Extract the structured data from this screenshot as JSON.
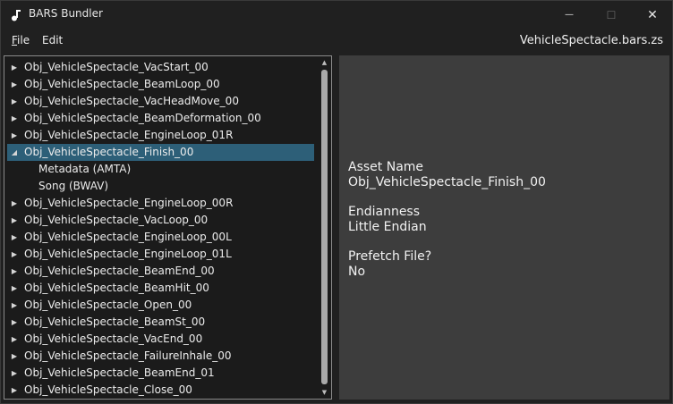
{
  "window": {
    "title": "BARS Bundler",
    "minimize_glyph": "—",
    "maximize_glyph": "☐",
    "close_glyph": "✕"
  },
  "menu": {
    "file_accel": "F",
    "file_rest": "ile",
    "edit": "Edit",
    "filename": "VehicleSpectacle.bars.zs"
  },
  "tree": {
    "collapsed_glyph": "▶",
    "expanded_glyph": "◢",
    "items": [
      {
        "label": "Obj_VehicleSpectacle_VacStart_00",
        "expanded": false
      },
      {
        "label": "Obj_VehicleSpectacle_BeamLoop_00",
        "expanded": false
      },
      {
        "label": "Obj_VehicleSpectacle_VacHeadMove_00",
        "expanded": false
      },
      {
        "label": "Obj_VehicleSpectacle_BeamDeformation_00",
        "expanded": false
      },
      {
        "label": "Obj_VehicleSpectacle_EngineLoop_01R",
        "expanded": false
      },
      {
        "label": "Obj_VehicleSpectacle_Finish_00",
        "expanded": true,
        "selected": true
      },
      {
        "label": "Metadata (AMTA)",
        "child": true
      },
      {
        "label": "Song (BWAV)",
        "child": true
      },
      {
        "label": "Obj_VehicleSpectacle_EngineLoop_00R",
        "expanded": false
      },
      {
        "label": "Obj_VehicleSpectacle_VacLoop_00",
        "expanded": false
      },
      {
        "label": "Obj_VehicleSpectacle_EngineLoop_00L",
        "expanded": false
      },
      {
        "label": "Obj_VehicleSpectacle_EngineLoop_01L",
        "expanded": false
      },
      {
        "label": "Obj_VehicleSpectacle_BeamEnd_00",
        "expanded": false
      },
      {
        "label": "Obj_VehicleSpectacle_BeamHit_00",
        "expanded": false
      },
      {
        "label": "Obj_VehicleSpectacle_Open_00",
        "expanded": false
      },
      {
        "label": "Obj_VehicleSpectacle_BeamSt_00",
        "expanded": false
      },
      {
        "label": "Obj_VehicleSpectacle_VacEnd_00",
        "expanded": false
      },
      {
        "label": "Obj_VehicleSpectacle_FailureInhale_00",
        "expanded": false
      },
      {
        "label": "Obj_VehicleSpectacle_BeamEnd_01",
        "expanded": false
      },
      {
        "label": "Obj_VehicleSpectacle_Close_00",
        "expanded": false
      }
    ]
  },
  "details": {
    "asset_name_label": "Asset Name",
    "asset_name_value": "Obj_VehicleSpectacle_Finish_00",
    "endianness_label": "Endianness",
    "endianness_value": "Little Endian",
    "prefetch_label": "Prefetch File?",
    "prefetch_value": "No"
  },
  "colors": {
    "selection": "#2d5f78",
    "details_background": "#3d3d3d",
    "window_background": "#202020"
  }
}
